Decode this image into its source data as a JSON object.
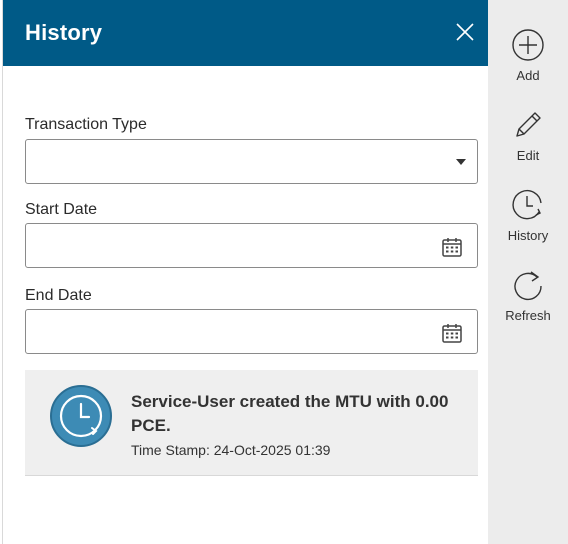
{
  "panel": {
    "title": "History",
    "close_icon": "close-icon"
  },
  "form": {
    "transaction_type": {
      "label": "Transaction Type",
      "value": "",
      "icon": "caret-down-icon"
    },
    "start_date": {
      "label": "Start Date",
      "value": "",
      "icon": "calendar-icon"
    },
    "end_date": {
      "label": "End Date",
      "value": "",
      "icon": "calendar-icon"
    }
  },
  "history": {
    "items": [
      {
        "icon": "clock-icon",
        "message": "Service-User created the MTU with 0.00 PCE.",
        "timestamp": "Time Stamp: 24-Oct-2025 01:39"
      }
    ]
  },
  "toolbar": {
    "items": [
      {
        "label": "Add",
        "icon": "plus-circle-icon"
      },
      {
        "label": "Edit",
        "icon": "pencil-icon"
      },
      {
        "label": "History",
        "icon": "history-icon"
      },
      {
        "label": "Refresh",
        "icon": "refresh-icon"
      }
    ]
  },
  "colors": {
    "header": "#005a87",
    "icon_blue": "#3d8bb5",
    "card_bg": "#efefef",
    "toolbar_bg": "#ececec"
  }
}
